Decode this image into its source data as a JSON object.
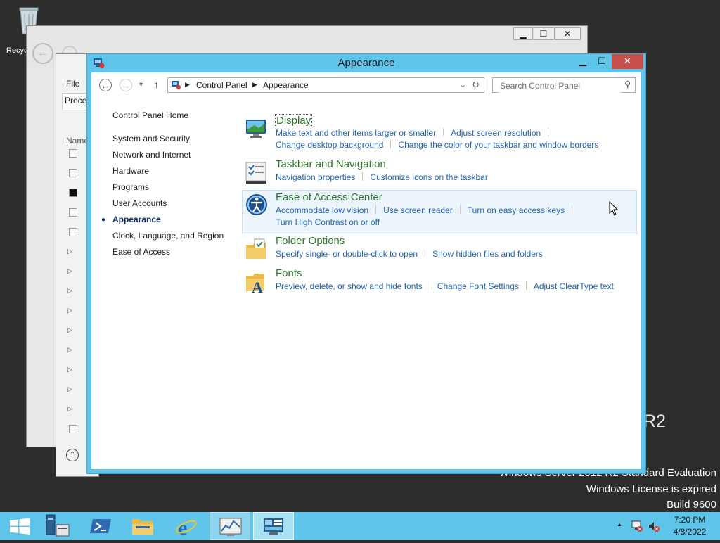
{
  "desktop": {
    "recycle_bin_label": "Recyc",
    "watermark_r2": "R2",
    "watermark_lines": [
      "Windows Server 2012 R2 Standard Evaluation",
      "Windows License is expired",
      "Build 9600"
    ]
  },
  "background_windows": {
    "explorer_menu_file": "File",
    "explorer_tab": "Proce",
    "explorer_column_name": "Name"
  },
  "window": {
    "title": "Appearance",
    "minimize_glyph": "▁",
    "maximize_glyph": "☐",
    "close_glyph": "✕"
  },
  "address_bar": {
    "back_glyph": "←",
    "forward_glyph": "→",
    "recent_glyph": "▾",
    "up_glyph": "↑",
    "crumbs": [
      "Control Panel",
      "Appearance"
    ],
    "dropdown_glyph": "⌄",
    "refresh_glyph": "↻"
  },
  "search": {
    "placeholder": "Search Control Panel",
    "icon_glyph": "⚲"
  },
  "left_nav": {
    "home": "Control Panel Home",
    "items": [
      "System and Security",
      "Network and Internet",
      "Hardware",
      "Programs",
      "User Accounts",
      "Appearance",
      "Clock, Language, and Region",
      "Ease of Access"
    ],
    "active_index": 5,
    "bullet": "●"
  },
  "categories": [
    {
      "heading": "Display",
      "icon": "display-icon",
      "lines": [
        [
          "Make text and other items larger or smaller",
          "Adjust screen resolution",
          ""
        ],
        [
          "Change desktop background",
          "Change the color of your taskbar and window borders"
        ]
      ]
    },
    {
      "heading": "Taskbar and Navigation",
      "icon": "taskbar-icon",
      "lines": [
        [
          "Navigation properties",
          "Customize icons on the taskbar"
        ]
      ]
    },
    {
      "heading": "Ease of Access Center",
      "icon": "ease-of-access-icon",
      "lines": [
        [
          "Accommodate low vision",
          "Use screen reader",
          "Turn on easy access keys",
          ""
        ],
        [
          "Turn High Contrast on or off"
        ]
      ]
    },
    {
      "heading": "Folder Options",
      "icon": "folder-options-icon",
      "lines": [
        [
          "Specify single- or double-click to open",
          "Show hidden files and folders"
        ]
      ]
    },
    {
      "heading": "Fonts",
      "icon": "fonts-icon",
      "lines": [
        [
          "Preview, delete, or show and hide fonts",
          "Change Font Settings",
          "Adjust ClearType text"
        ]
      ]
    }
  ],
  "taskbar": {
    "buttons": [
      "start-button",
      "server-manager-button",
      "powershell-button",
      "file-explorer-button",
      "internet-explorer-button",
      "performance-monitor-button",
      "control-panel-button"
    ],
    "tray_arrow": "▲",
    "time": "7:20 PM",
    "date": "4/8/2022"
  },
  "colors": {
    "title_bar": "#5ec4e9",
    "close_button": "#c7504b",
    "heading_green": "#2c7a2c",
    "link_blue": "#1f65b5",
    "taskbar": "#5ec4e9"
  }
}
